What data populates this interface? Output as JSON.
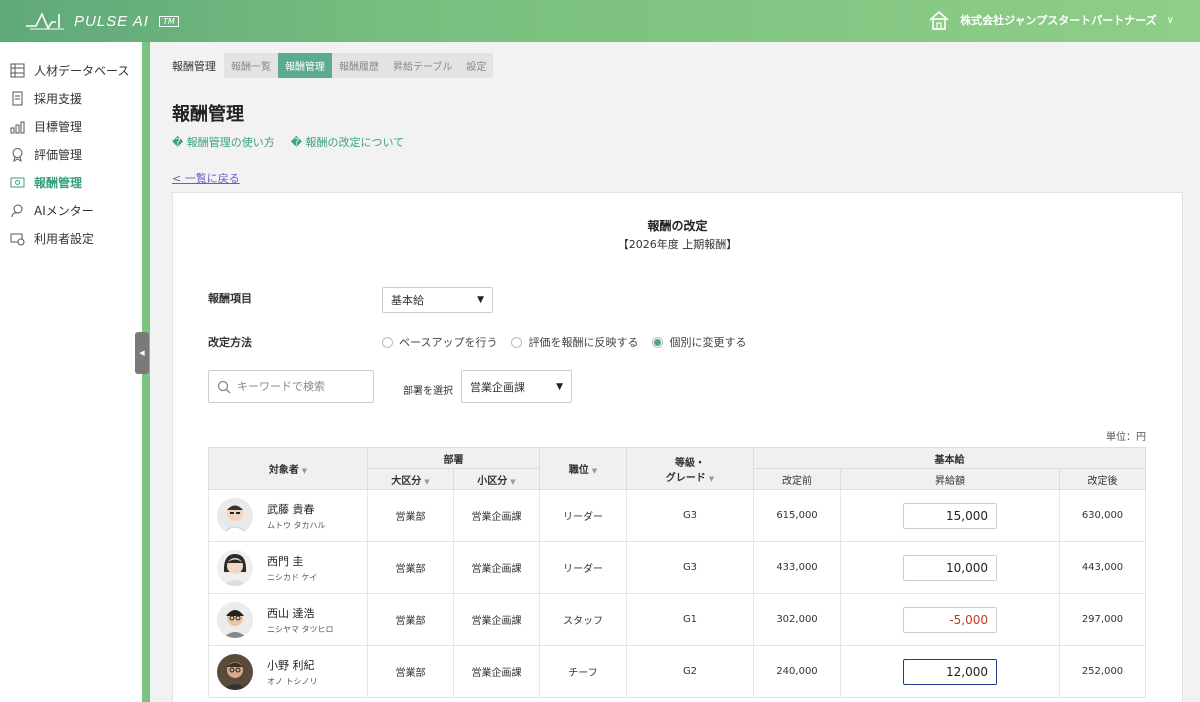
{
  "header": {
    "brand": "PULSE AI",
    "brand_mark": "TM",
    "company": "株式会社ジャンプスタートパートナーズ",
    "company_caret": "∨"
  },
  "sidebar": {
    "items": [
      {
        "label": "人材データベース",
        "icon": "database-icon"
      },
      {
        "label": "採用支援",
        "icon": "document-icon"
      },
      {
        "label": "目標管理",
        "icon": "goal-icon"
      },
      {
        "label": "評価管理",
        "icon": "badge-icon"
      },
      {
        "label": "報酬管理",
        "icon": "money-icon",
        "active": true
      },
      {
        "label": "AIメンター",
        "icon": "mentor-icon"
      },
      {
        "label": "利用者設定",
        "icon": "user-settings-icon"
      }
    ],
    "collapse_glyph": "◀"
  },
  "breadcrumb": {
    "title": "報酬管理",
    "tabs": [
      "報酬一覧",
      "報酬管理",
      "報酬履歴",
      "昇給テーブル",
      "設定"
    ],
    "active_tab": 1
  },
  "page": {
    "title": "報酬管理",
    "help_links": [
      "� 報酬管理の使い方",
      "� 報酬の改定について"
    ],
    "back_link": "< 一覧に戻る"
  },
  "panel": {
    "title": "報酬の改定",
    "subtitle": "【2026年度 上期報酬】",
    "item_label": "報酬項目",
    "item_value": "基本給",
    "method_label": "改定方法",
    "methods": [
      "ベースアップを行う",
      "評価を報酬に反映する",
      "個別に変更する"
    ],
    "method_selected": 2,
    "search_placeholder": "キーワードで検索",
    "dept_label": "部署を選択",
    "dept_value": "営業企画課",
    "unit": "単位：円"
  },
  "table": {
    "headers": {
      "person": "対象者",
      "dept": "部署",
      "major": "大区分",
      "minor": "小区分",
      "position": "職位",
      "grade": "等級・\nグレード",
      "base": "基本給",
      "before": "改定前",
      "raise": "昇給額",
      "after": "改定後"
    },
    "rows": [
      {
        "name": "武藤 貴春",
        "kana": "ムトウ タカハル",
        "major": "営業部",
        "minor": "営業企画課",
        "position": "リーダー",
        "grade": "G3",
        "before": "615,000",
        "raise": "15,000",
        "after": "630,000",
        "state": "normal"
      },
      {
        "name": "西門 圭",
        "kana": "ニシカド ケイ",
        "major": "営業部",
        "minor": "営業企画課",
        "position": "リーダー",
        "grade": "G3",
        "before": "433,000",
        "raise": "10,000",
        "after": "443,000",
        "state": "normal"
      },
      {
        "name": "西山 達浩",
        "kana": "ニシヤマ タツヒロ",
        "major": "営業部",
        "minor": "営業企画課",
        "position": "スタッフ",
        "grade": "G1",
        "before": "302,000",
        "raise": "-5,000",
        "after": "297,000",
        "state": "negative"
      },
      {
        "name": "小野 利紀",
        "kana": "オノ トシノリ",
        "major": "営業部",
        "minor": "営業企画課",
        "position": "チーフ",
        "grade": "G2",
        "before": "240,000",
        "raise": "12,000",
        "after": "252,000",
        "state": "focus"
      }
    ]
  },
  "colors": {
    "accent": "#5bab8e",
    "header_green": "#78bf7f",
    "negative": "#c0392b",
    "focus_border": "#1f3a8a"
  }
}
